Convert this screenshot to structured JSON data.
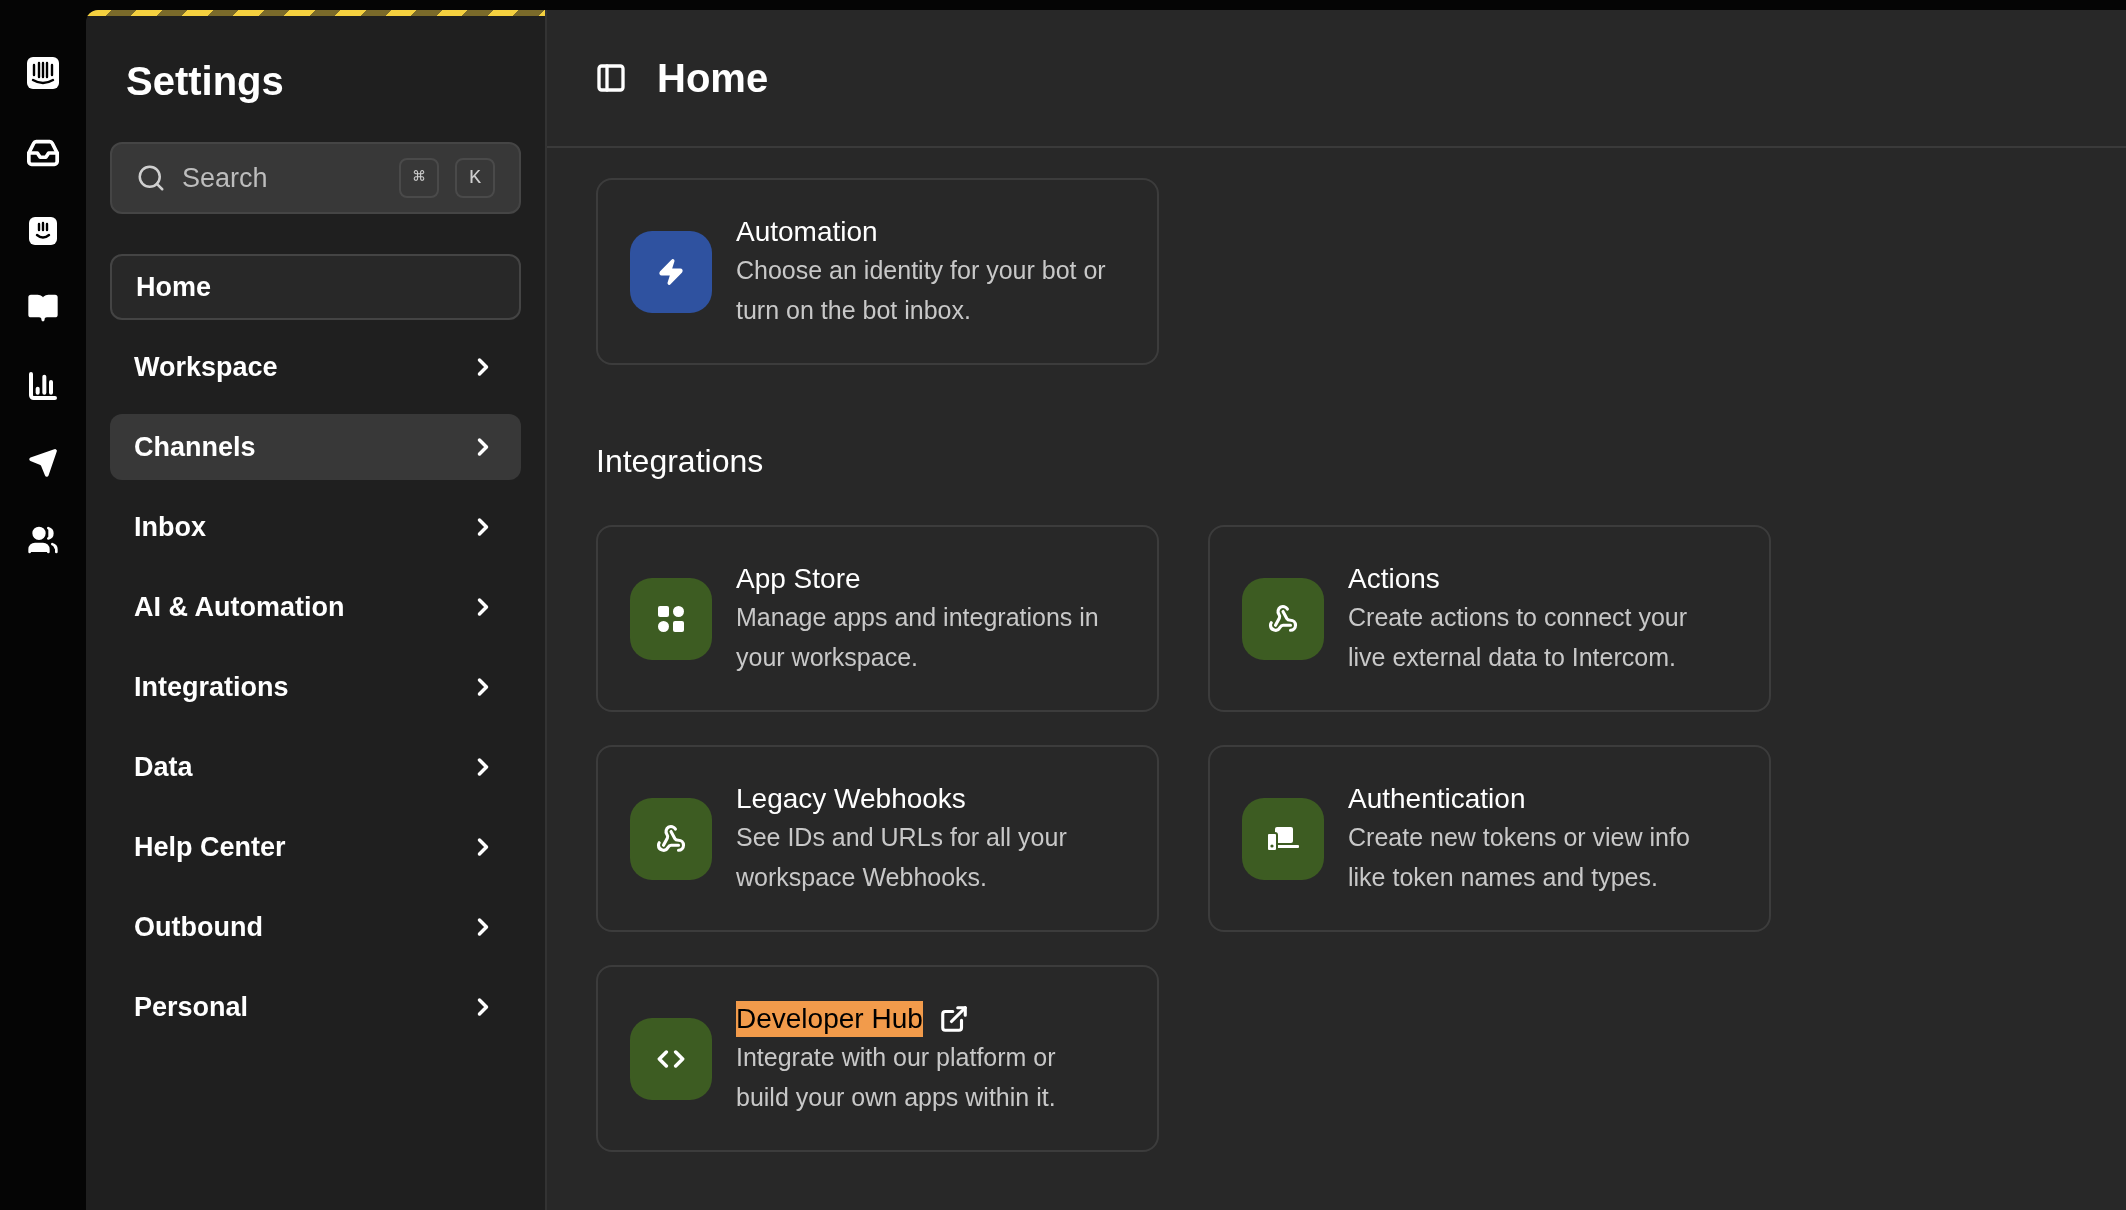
{
  "sidebar": {
    "title": "Settings",
    "search": {
      "placeholder": "Search",
      "shortcut_keys": [
        "⌘",
        "K"
      ]
    },
    "items": [
      {
        "label": "Home",
        "selected": true,
        "hovered": false,
        "expandable": false
      },
      {
        "label": "Workspace",
        "selected": false,
        "hovered": false,
        "expandable": true
      },
      {
        "label": "Channels",
        "selected": false,
        "hovered": true,
        "expandable": true
      },
      {
        "label": "Inbox",
        "selected": false,
        "hovered": false,
        "expandable": true
      },
      {
        "label": "AI & Automation",
        "selected": false,
        "hovered": false,
        "expandable": true
      },
      {
        "label": "Integrations",
        "selected": false,
        "hovered": false,
        "expandable": true
      },
      {
        "label": "Data",
        "selected": false,
        "hovered": false,
        "expandable": true
      },
      {
        "label": "Help Center",
        "selected": false,
        "hovered": false,
        "expandable": true
      },
      {
        "label": "Outbound",
        "selected": false,
        "hovered": false,
        "expandable": true
      },
      {
        "label": "Personal",
        "selected": false,
        "hovered": false,
        "expandable": true
      }
    ]
  },
  "main": {
    "title": "Home",
    "sections": [
      {
        "cards": [
          {
            "kind": "bolt",
            "color": "#2f52a0",
            "title": "Automation",
            "description": "Choose an identity for your bot or turn on the bot inbox.",
            "highlighted": false,
            "external": false
          }
        ]
      },
      {
        "heading": "Integrations",
        "cards": [
          {
            "kind": "grid",
            "color": "#3d5c22",
            "title": "App Store",
            "description": "Manage apps and integrations in your workspace.",
            "highlighted": false,
            "external": false
          },
          {
            "kind": "webhook",
            "color": "#3d5c22",
            "title": "Actions",
            "description": "Create actions to connect your live external data to Intercom.",
            "highlighted": false,
            "external": false
          },
          {
            "kind": "webhook",
            "color": "#3d5c22",
            "title": "Legacy Webhooks",
            "description": "See IDs and URLs for all your workspace Webhooks.",
            "highlighted": false,
            "external": false
          },
          {
            "kind": "token",
            "color": "#3d5c22",
            "title": "Authentication",
            "description": "Create new tokens or view info like token names and types.",
            "highlighted": false,
            "external": false
          },
          {
            "kind": "code",
            "color": "#3d5c22",
            "title": "Developer Hub",
            "description": "Integrate with our platform or build your own apps within it.",
            "highlighted": true,
            "external": true
          }
        ]
      }
    ]
  }
}
